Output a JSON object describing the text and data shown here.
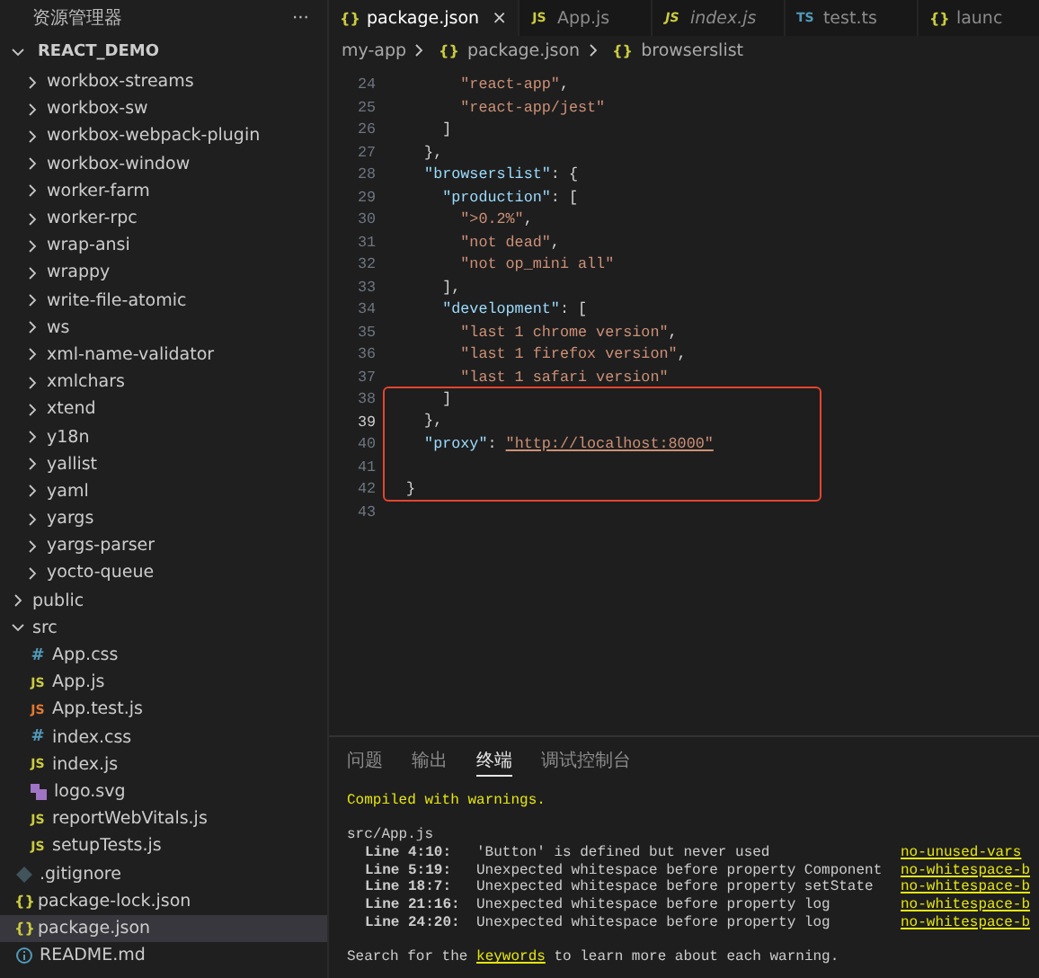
{
  "explorer": {
    "title": "资源管理器",
    "more": "···",
    "root": {
      "label": "REACT_DEMO",
      "expanded": true
    },
    "items": [
      {
        "kind": "container",
        "children": [
          {
            "kind": "folder",
            "label": "workbox-streams",
            "expanded": false,
            "selected": false
          },
          {
            "kind": "folder",
            "label": "workbox-sw",
            "expanded": false,
            "selected": false
          },
          {
            "kind": "folder",
            "label": "workbox-webpack-plugin",
            "expanded": false,
            "selected": false
          },
          {
            "kind": "folder",
            "label": "workbox-window",
            "expanded": false,
            "selected": false
          },
          {
            "kind": "folder",
            "label": "worker-farm",
            "expanded": false,
            "selected": false
          },
          {
            "kind": "folder",
            "label": "worker-rpc",
            "expanded": false,
            "selected": false
          },
          {
            "kind": "folder",
            "label": "wrap-ansi",
            "expanded": false,
            "selected": false
          },
          {
            "kind": "folder",
            "label": "wrappy",
            "expanded": false,
            "selected": false
          },
          {
            "kind": "folder",
            "label": "write-file-atomic",
            "expanded": false,
            "selected": false
          },
          {
            "kind": "folder",
            "label": "ws",
            "expanded": false,
            "selected": false
          },
          {
            "kind": "folder",
            "label": "xml-name-validator",
            "expanded": false,
            "selected": false
          },
          {
            "kind": "folder",
            "label": "xmlchars",
            "expanded": false,
            "selected": false
          },
          {
            "kind": "folder",
            "label": "xtend",
            "expanded": false,
            "selected": false
          },
          {
            "kind": "folder",
            "label": "y18n",
            "expanded": false,
            "selected": false
          },
          {
            "kind": "folder",
            "label": "yallist",
            "expanded": false,
            "selected": false
          },
          {
            "kind": "folder",
            "label": "yaml",
            "expanded": false,
            "selected": false
          },
          {
            "kind": "folder",
            "label": "yargs",
            "expanded": false,
            "selected": false
          },
          {
            "kind": "folder",
            "label": "yargs-parser",
            "expanded": false,
            "selected": false
          },
          {
            "kind": "folder",
            "label": "yocto-queue",
            "expanded": false,
            "selected": false
          }
        ]
      },
      {
        "kind": "folder",
        "label": "public",
        "expanded": false,
        "selected": false
      },
      {
        "kind": "folder",
        "label": "src",
        "expanded": true,
        "selected": false,
        "children": [
          {
            "kind": "css",
            "icon": "#",
            "label": "App.css",
            "selected": false
          },
          {
            "kind": "js",
            "icon": "JS",
            "label": "App.js",
            "selected": false
          },
          {
            "kind": "test",
            "icon": "JS",
            "label": "App.test.js",
            "selected": false
          },
          {
            "kind": "css",
            "icon": "#",
            "label": "index.css",
            "selected": false
          },
          {
            "kind": "js",
            "icon": "JS",
            "label": "index.js",
            "selected": false
          },
          {
            "kind": "svg",
            "label": "logo.svg",
            "selected": false
          },
          {
            "kind": "js",
            "icon": "JS",
            "label": "reportWebVitals.js",
            "selected": false
          },
          {
            "kind": "js",
            "icon": "JS",
            "label": "setupTests.js",
            "selected": false
          }
        ]
      },
      {
        "kind": "git",
        "label": ".gitignore",
        "selected": false
      },
      {
        "kind": "json",
        "icon": "{}",
        "label": "package-lock.json",
        "selected": false
      },
      {
        "kind": "json",
        "icon": "{}",
        "label": "package.json",
        "selected": true
      },
      {
        "kind": "info",
        "label": "README.md",
        "selected": false
      }
    ]
  },
  "tabs": [
    {
      "kind": "json",
      "icon": "{}",
      "label": "package.json",
      "selected": true,
      "preview": false,
      "close": "×"
    },
    {
      "kind": "js",
      "icon": "JS",
      "label": "App.js",
      "selected": false,
      "preview": false
    },
    {
      "kind": "js",
      "icon": "JS",
      "label": "index.js",
      "selected": false,
      "preview": true
    },
    {
      "kind": "ts",
      "icon": "TS",
      "label": "test.ts",
      "selected": false,
      "preview": false
    },
    {
      "kind": "json",
      "icon": "{}",
      "label": "launc",
      "selected": false,
      "preview": false
    }
  ],
  "breadcrumb": [
    {
      "label": "my-app"
    },
    {
      "kind": "json",
      "icon": "{}",
      "label": "package.json"
    },
    {
      "kind": "json",
      "icon": "{}",
      "label": "browserslist"
    }
  ],
  "code": {
    "lines": [
      {
        "number": "24",
        "current": false,
        "boxed": false,
        "tokens": [
          {
            "kind": "string",
            "text": "      \"react-app\""
          },
          {
            "kind": "punct",
            "text": ","
          }
        ]
      },
      {
        "number": "25",
        "current": false,
        "boxed": false,
        "tokens": [
          {
            "kind": "string",
            "text": "      \"react-app/jest\""
          }
        ]
      },
      {
        "number": "26",
        "current": false,
        "boxed": false,
        "tokens": [
          {
            "kind": "punct",
            "text": "    ]"
          }
        ]
      },
      {
        "number": "27",
        "current": false,
        "boxed": false,
        "tokens": [
          {
            "kind": "punct",
            "text": "  },"
          }
        ]
      },
      {
        "number": "28",
        "current": false,
        "boxed": false,
        "tokens": [
          {
            "kind": "key",
            "text": "  \"browserslist\""
          },
          {
            "kind": "punct",
            "text": ": {"
          }
        ]
      },
      {
        "number": "29",
        "current": false,
        "boxed": false,
        "tokens": [
          {
            "kind": "key",
            "text": "    \"production\""
          },
          {
            "kind": "punct",
            "text": ": ["
          }
        ]
      },
      {
        "number": "30",
        "current": false,
        "boxed": false,
        "tokens": [
          {
            "kind": "string",
            "text": "      \">0.2%\""
          },
          {
            "kind": "punct",
            "text": ","
          }
        ]
      },
      {
        "number": "31",
        "current": false,
        "boxed": false,
        "tokens": [
          {
            "kind": "string",
            "text": "      \"not dead\""
          },
          {
            "kind": "punct",
            "text": ","
          }
        ]
      },
      {
        "number": "32",
        "current": false,
        "boxed": false,
        "tokens": [
          {
            "kind": "string",
            "text": "      \"not op_mini all\""
          }
        ]
      },
      {
        "number": "33",
        "current": false,
        "boxed": false,
        "tokens": [
          {
            "kind": "punct",
            "text": "    ],"
          }
        ]
      },
      {
        "number": "34",
        "current": false,
        "boxed": false,
        "tokens": [
          {
            "kind": "key",
            "text": "    \"development\""
          },
          {
            "kind": "punct",
            "text": ": ["
          }
        ]
      },
      {
        "number": "35",
        "current": false,
        "boxed": false,
        "tokens": [
          {
            "kind": "string",
            "text": "      \"last 1 chrome version\""
          },
          {
            "kind": "punct",
            "text": ","
          }
        ]
      },
      {
        "number": "36",
        "current": false,
        "boxed": false,
        "tokens": [
          {
            "kind": "string",
            "text": "      \"last 1 firefox version\""
          },
          {
            "kind": "punct",
            "text": ","
          }
        ]
      },
      {
        "number": "37",
        "current": false,
        "boxed": false,
        "tokens": [
          {
            "kind": "string",
            "text": "      \"last 1 safari version\""
          }
        ]
      },
      {
        "number": "38",
        "current": false,
        "boxed": true,
        "tokens": [
          {
            "kind": "punct",
            "text": "    ]"
          }
        ]
      },
      {
        "number": "39",
        "current": true,
        "boxed": true,
        "tokens": [
          {
            "kind": "punct",
            "text": "  },"
          }
        ]
      },
      {
        "number": "40",
        "current": false,
        "boxed": true,
        "tokens": [
          {
            "kind": "key",
            "text": "  \"proxy\""
          },
          {
            "kind": "punct",
            "text": ": "
          },
          {
            "kind": "link",
            "text": "\"http://localhost:8000\""
          }
        ]
      },
      {
        "number": "41",
        "current": false,
        "boxed": true
      },
      {
        "number": "42",
        "current": false,
        "boxed": true,
        "tokens": [
          {
            "kind": "punct",
            "text": "}"
          }
        ]
      },
      {
        "number": "43",
        "current": false,
        "boxed": false
      }
    ]
  },
  "panel": {
    "tabs": [
      {
        "label": "问题",
        "selected": false
      },
      {
        "label": "输出",
        "selected": false
      },
      {
        "label": "终端",
        "selected": true
      },
      {
        "label": "调试控制台",
        "selected": false
      }
    ],
    "terminal": {
      "status": "Compiled with warnings.",
      "file": "src/App.js",
      "warnings": [
        {
          "location": "Line 4:10:",
          "message": "'Button' is defined but never used",
          "rule": "no-unused-vars"
        },
        {
          "location": "Line 5:19:",
          "message": "Unexpected whitespace before property Component",
          "rule": "no-whitespace-b"
        },
        {
          "location": "Line 18:7:",
          "message": "Unexpected whitespace before property setState",
          "rule": "no-whitespace-b"
        },
        {
          "location": "Line 21:16:",
          "message": "Unexpected whitespace before property log",
          "rule": "no-whitespace-b"
        },
        {
          "location": "Line 24:20:",
          "message": "Unexpected whitespace before property log",
          "rule": "no-whitespace-b"
        }
      ],
      "footer": [
        {
          "kind": "text",
          "text": "Search for the "
        },
        {
          "kind": "link",
          "text": "keywords"
        },
        {
          "kind": "text",
          "text": " to learn more about each warning."
        }
      ]
    }
  }
}
